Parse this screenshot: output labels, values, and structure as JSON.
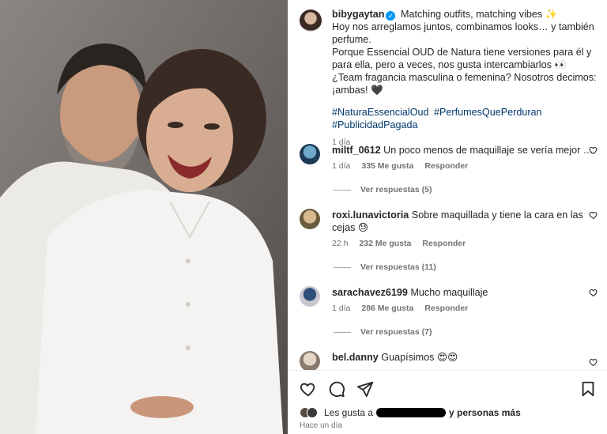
{
  "post": {
    "username": "bibygaytan",
    "caption_lines": [
      "Matching outfits, matching vibes ✨",
      "Hoy nos arreglamos juntos, combinamos looks… y también perfume.",
      "Porque Essencial OUD de Natura tiene versiones para él y para ella, pero a veces, nos gusta intercambiarlos 👀",
      "¿Team fragancia masculina o femenina? Nosotros decimos: ¡ambas! 🖤"
    ],
    "hashtags": [
      "#NaturaEssencialOud",
      "#PerfumesQuePerduran",
      "#PublicidadPagada"
    ],
    "age": "1 día"
  },
  "comments": [
    {
      "username": "miltf_0612",
      "text": "Un poco menos de maquillaje se vería mejor …",
      "age": "1 día",
      "likes": "335 Me gusta",
      "reply": "Responder",
      "replies": "Ver respuestas (5)"
    },
    {
      "username": "roxi.lunavictoria",
      "text": "Sobre maquillada y tiene la cara en las cejas 😓",
      "age": "22 h",
      "likes": "232 Me gusta",
      "reply": "Responder",
      "replies": "Ver respuestas (11)"
    },
    {
      "username": "sarachavez6199",
      "text": "Mucho maquillaje",
      "age": "1 día",
      "likes": "286 Me gusta",
      "reply": "Responder",
      "replies": "Ver respuestas (7)"
    },
    {
      "username": "bel.danny",
      "text": "Guapísimos 😍😍"
    }
  ],
  "footer": {
    "likes_prefix": "Les gusta a",
    "likes_suffix": "y personas más",
    "time": "Hace un día"
  },
  "icons": {
    "verified": "✓"
  }
}
